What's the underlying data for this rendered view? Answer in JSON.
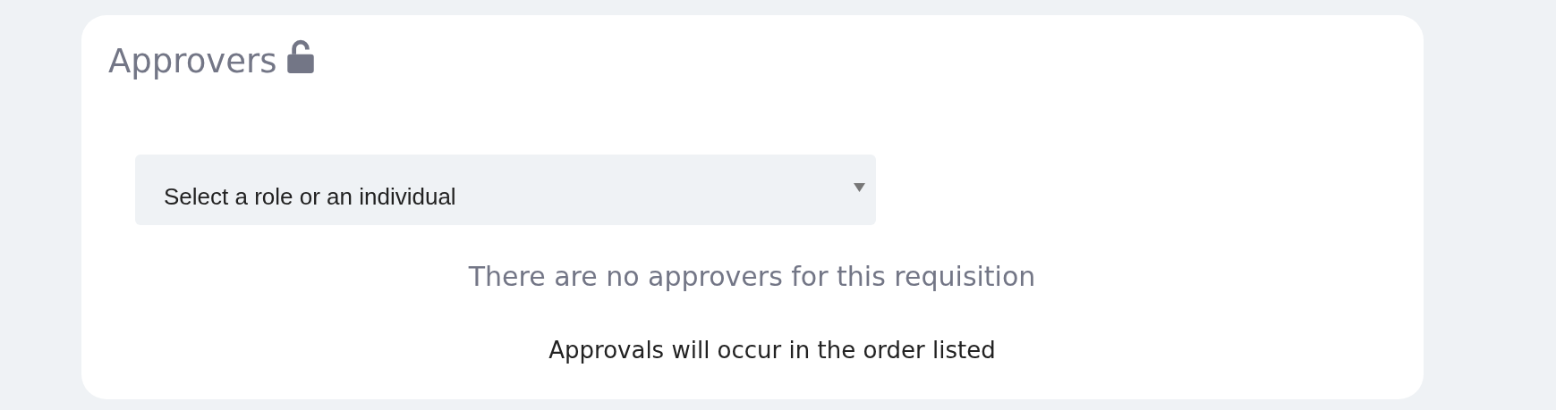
{
  "section": {
    "title": "Approvers",
    "locked": false
  },
  "approver_select": {
    "placeholder": "Select a role or an individual"
  },
  "empty_message": "There are no approvers for this requisition",
  "order_note": "Approvals will occur in the order listed"
}
